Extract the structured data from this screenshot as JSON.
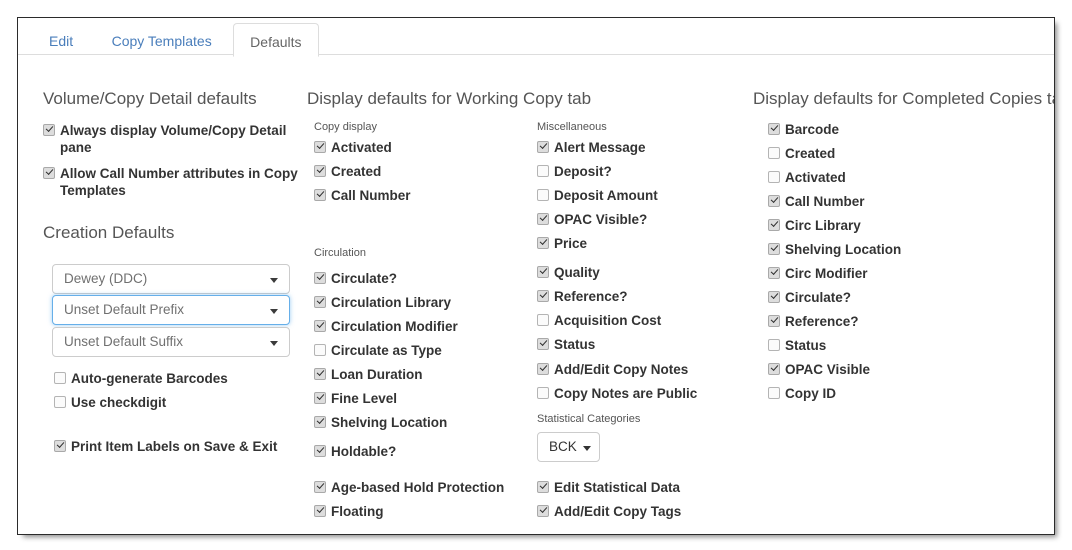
{
  "tabs": [
    {
      "label": "Edit",
      "active": false
    },
    {
      "label": "Copy Templates",
      "active": false
    },
    {
      "label": "Defaults",
      "active": true
    }
  ],
  "left_column": {
    "heading": "Volume/Copy Detail defaults",
    "checkboxes": [
      {
        "label": "Always display Volume/Copy Detail pane",
        "checked": true
      },
      {
        "label": "Allow Call Number attributes in Copy Templates",
        "checked": true
      }
    ],
    "creation_defaults": {
      "heading": "Creation Defaults",
      "selects": [
        {
          "value": "Dewey (DDC)",
          "focused": false
        },
        {
          "value": "Unset Default Prefix",
          "focused": true
        },
        {
          "value": "Unset Default Suffix",
          "focused": false
        }
      ],
      "checkboxes": [
        {
          "label": "Auto-generate Barcodes",
          "checked": false
        },
        {
          "label": "Use checkdigit",
          "checked": false
        },
        {
          "label": "Print Item Labels on Save & Exit",
          "checked": true
        }
      ]
    }
  },
  "middle_column": {
    "heading": "Display defaults for Working Copy tab",
    "groups": [
      {
        "subhead": "Copy display",
        "items": [
          {
            "label": "Activated",
            "checked": true
          },
          {
            "label": "Created",
            "checked": true
          },
          {
            "label": "Call Number",
            "checked": true
          }
        ]
      },
      {
        "subhead": "Circulation",
        "items": [
          {
            "label": "Circulate?",
            "checked": true
          },
          {
            "label": "Circulation Library",
            "checked": true
          },
          {
            "label": "Circulation Modifier",
            "checked": true
          },
          {
            "label": "Circulate as Type",
            "checked": false
          },
          {
            "label": "Loan Duration",
            "checked": true
          },
          {
            "label": "Fine Level",
            "checked": true
          },
          {
            "label": "Shelving Location",
            "checked": true
          },
          {
            "label": "Holdable?",
            "checked": true
          },
          {
            "label": "Age-based Hold Protection",
            "checked": true
          },
          {
            "label": "Floating",
            "checked": true
          }
        ]
      },
      {
        "subhead": "Miscellaneous",
        "items": [
          {
            "label": "Alert Message",
            "checked": true
          },
          {
            "label": "Deposit?",
            "checked": false
          },
          {
            "label": "Deposit Amount",
            "checked": false
          },
          {
            "label": "OPAC Visible?",
            "checked": true
          },
          {
            "label": "Price",
            "checked": true
          },
          {
            "label": "Quality",
            "checked": true
          },
          {
            "label": "Reference?",
            "checked": true
          },
          {
            "label": "Acquisition Cost",
            "checked": false
          },
          {
            "label": "Status",
            "checked": true
          },
          {
            "label": "Add/Edit Copy Notes",
            "checked": true
          },
          {
            "label": "Copy Notes are Public",
            "checked": false
          }
        ]
      },
      {
        "subhead": "Statistical Categories",
        "dropdown_label": "BCK",
        "items": [
          {
            "label": "Edit Statistical Data",
            "checked": true
          },
          {
            "label": "Add/Edit Copy Tags",
            "checked": true
          }
        ]
      }
    ]
  },
  "right_column": {
    "heading": "Display defaults for Completed Copies tab",
    "items": [
      {
        "label": "Barcode",
        "checked": true
      },
      {
        "label": "Created",
        "checked": false
      },
      {
        "label": "Activated",
        "checked": false
      },
      {
        "label": "Call Number",
        "checked": true
      },
      {
        "label": "Circ Library",
        "checked": true
      },
      {
        "label": "Shelving Location",
        "checked": true
      },
      {
        "label": "Circ Modifier",
        "checked": true
      },
      {
        "label": "Circulate?",
        "checked": true
      },
      {
        "label": "Reference?",
        "checked": true
      },
      {
        "label": "Status",
        "checked": false
      },
      {
        "label": "OPAC Visible",
        "checked": true
      },
      {
        "label": "Copy ID",
        "checked": false
      }
    ]
  },
  "colors": {
    "tab_link": "#4a7ebb",
    "tab_active_text": "#666666",
    "heading": "#555555",
    "label": "#333333",
    "focus_ring": "#66afe9"
  }
}
